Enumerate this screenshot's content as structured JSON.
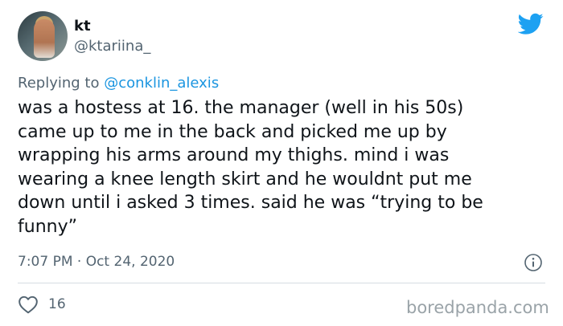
{
  "author": {
    "display_name": "kt",
    "handle": "@ktariina_"
  },
  "reply": {
    "prefix": "Replying to",
    "mention": "@conklin_alexis"
  },
  "body_lines": [
    "was a hostess at 16. the manager (well in his 50s)",
    "came up to me in the back and picked me up by",
    "wrapping his arms around my thighs. mind i was",
    "wearing a knee length skirt and he wouldnt put me",
    "down until i asked 3 times. said he was “trying to be",
    "funny”"
  ],
  "meta": {
    "timestamp": "7:07 PM · Oct 24, 2020"
  },
  "engagement": {
    "likes": "16"
  },
  "watermark": "boredpanda.com",
  "icons": {
    "brand": "twitter-bird-icon",
    "info": "info-icon",
    "like": "heart-icon"
  },
  "colors": {
    "twitter_blue": "#1da1f2",
    "link": "#1b95e0",
    "muted": "#536471",
    "text": "#0f1419"
  }
}
